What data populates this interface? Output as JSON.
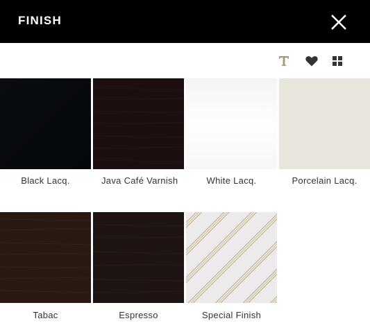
{
  "header": {
    "title": "FINISH"
  },
  "toolbar": {
    "icons": [
      "text-icon",
      "heart-icon",
      "grid-icon"
    ],
    "accent_color": "#a8977c",
    "icon_color": "#333333"
  },
  "finishes": [
    {
      "label": "Black Lacq.",
      "color": "#05080b"
    },
    {
      "label": "Java Café Varnish",
      "color": "#1b100f"
    },
    {
      "label": "White Lacq.",
      "color": "#fcfcfc"
    },
    {
      "label": "Porcelain Lacq.",
      "color": "#e8e5dd"
    },
    {
      "label": "Tabac",
      "color": "#2a1812"
    },
    {
      "label": "Espresso",
      "color": "#1e1414"
    },
    {
      "label": "Special Finish",
      "color": "#eceaea"
    }
  ]
}
